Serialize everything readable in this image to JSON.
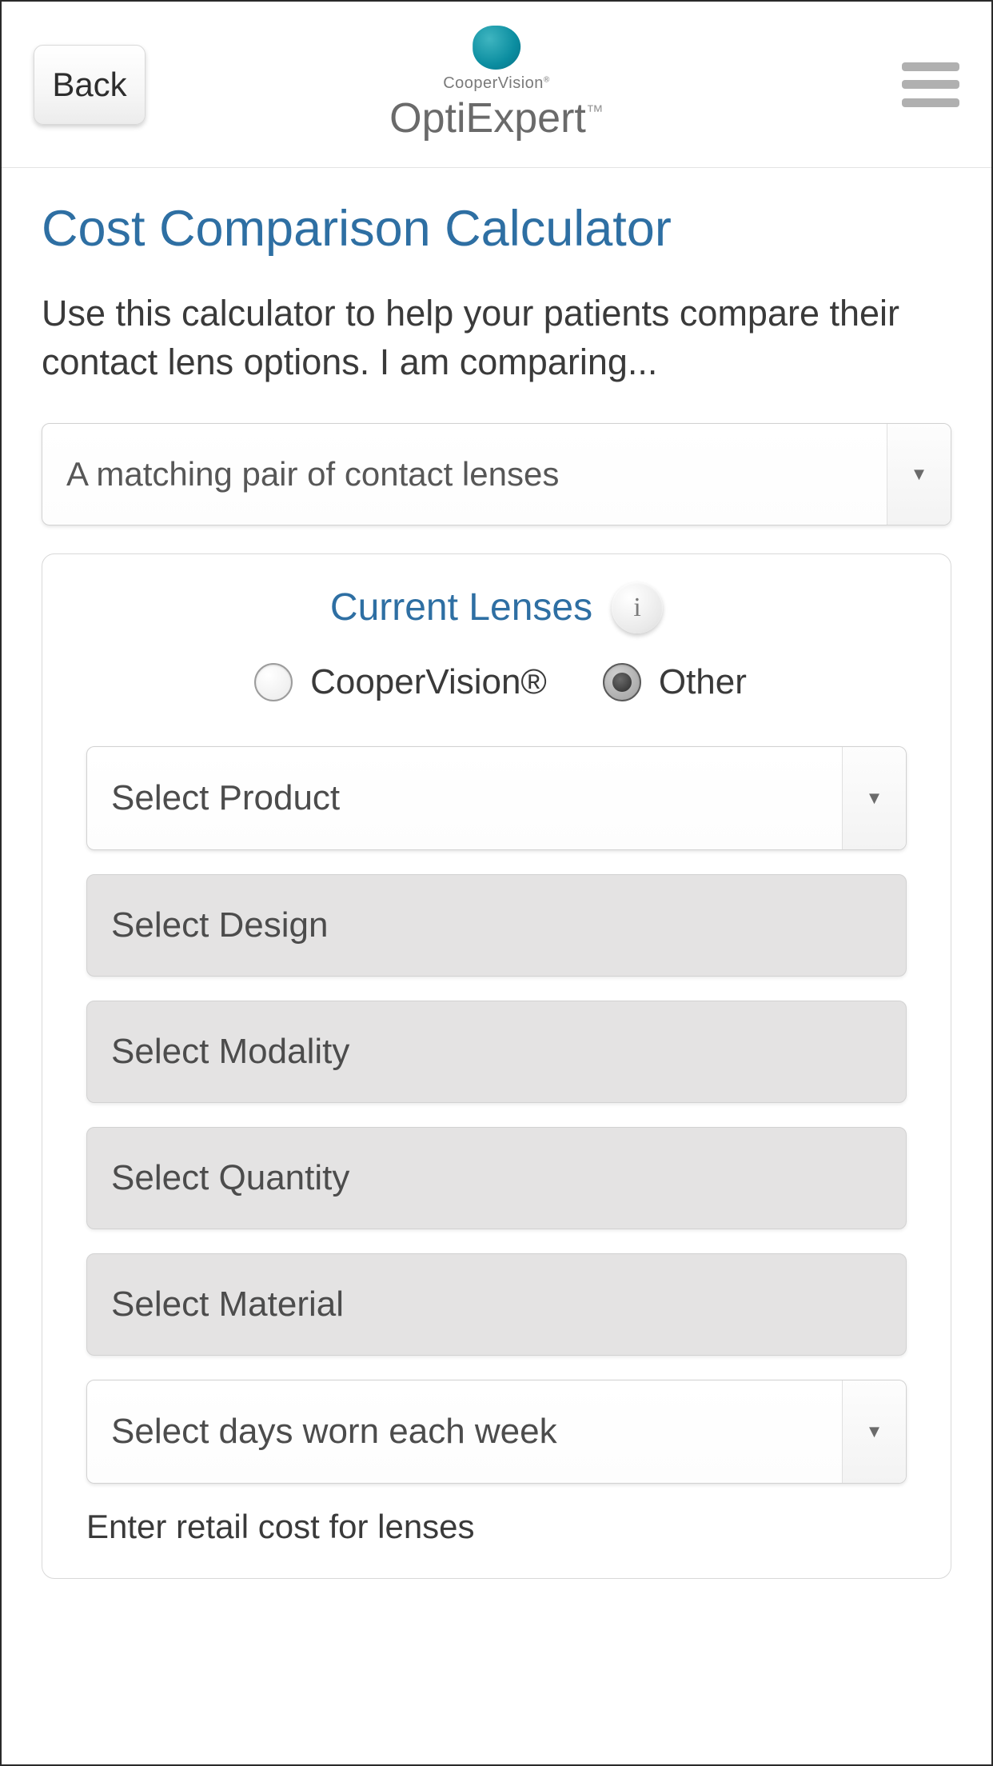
{
  "header": {
    "back_label": "Back",
    "brand_sub": "CooperVision",
    "brand_title": "OptiExpert",
    "brand_tm": "™"
  },
  "page": {
    "title": "Cost Comparison Calculator",
    "intro": "Use this calculator to help your patients compare their contact lens options.   I am comparing...",
    "compare_select": "A matching pair of contact lenses"
  },
  "card": {
    "title": "Current Lenses",
    "info_glyph": "i",
    "radio": {
      "option_a": "CooperVision®",
      "option_b": "Other",
      "selected": "b"
    },
    "fields": {
      "product": "Select Product",
      "design": "Select Design",
      "modality": "Select Modality",
      "quantity": "Select Quantity",
      "material": "Select Material",
      "days": "Select days worn each week",
      "retail_label": "Enter retail cost for lenses"
    }
  },
  "glyphs": {
    "caret": "▼"
  }
}
